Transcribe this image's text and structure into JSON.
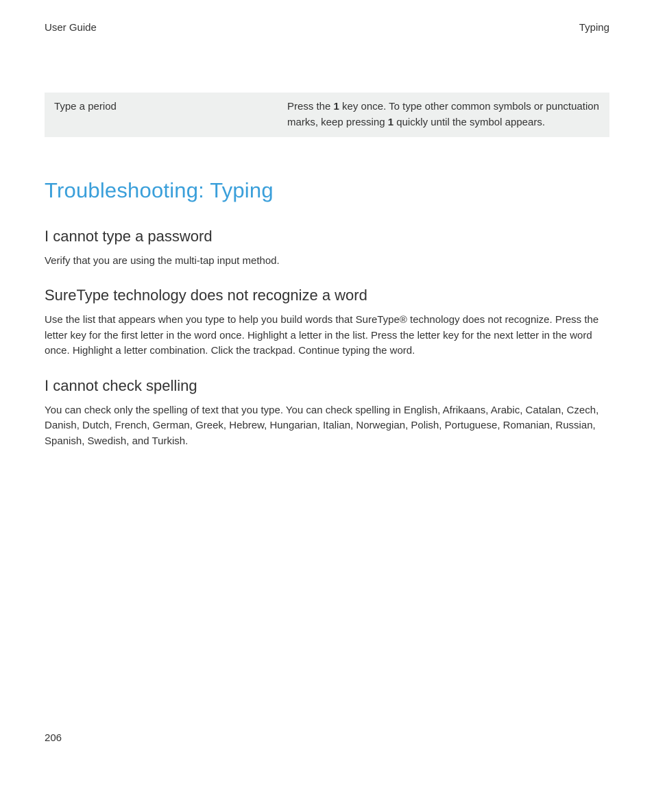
{
  "header": {
    "left": "User Guide",
    "right": "Typing"
  },
  "table": {
    "left": "Type a period",
    "right_prefix": "Press the ",
    "right_bold1": "1",
    "right_mid": " key once. To type other common symbols or punctuation marks, keep pressing ",
    "right_bold2": "1",
    "right_suffix": " quickly until the symbol appears."
  },
  "section_title": "Troubleshooting: Typing",
  "sections": [
    {
      "heading": "I cannot type a password",
      "body": "Verify that you are using the multi-tap input method."
    },
    {
      "heading": "SureType technology does not recognize a word",
      "body": "Use the list that appears when you type to help you build words that SureType® technology does not recognize. Press the letter key for the first letter in the word once. Highlight a letter in the list. Press the letter key for the next letter in the word once. Highlight a letter combination. Click the trackpad. Continue typing the word."
    },
    {
      "heading": "I cannot check spelling",
      "body": "You can check only the spelling of text that you type. You can check spelling in English, Afrikaans, Arabic, Catalan, Czech, Danish, Dutch, French, German, Greek, Hebrew, Hungarian, Italian, Norwegian, Polish, Portuguese, Romanian, Russian, Spanish, Swedish, and Turkish."
    }
  ],
  "page_number": "206"
}
